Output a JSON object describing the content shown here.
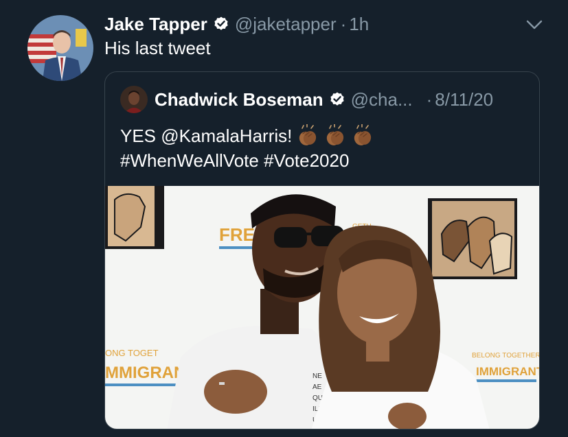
{
  "tweet": {
    "author_name": "Jake Tapper",
    "handle": "@jaketapper",
    "separator": "·",
    "time": "1h",
    "text": "His last tweet"
  },
  "quote": {
    "author_name": "Chadwick Boseman",
    "handle": "@cha...",
    "separator": "·",
    "time": "8/11/20",
    "line1": "YES @KamalaHarris!",
    "line2": "#WhenWeAllVote #Vote2020",
    "emoji": [
      "clapping-hands-medium-dark",
      "clapping-hands-medium-dark",
      "clapping-hands-medium-dark"
    ]
  },
  "photo": {
    "backdrop_text": {
      "freedom": "FREED",
      "belong_left": "ONG TOGET",
      "immigrants_left": "MMIGRAN",
      "belong_right": "BELONG TOGETHER",
      "immigrants_right": "IMMIGRANTS!",
      "shirt": "NE\nAE\nQUL\nILL\nUSR",
      "top_sign": "GETH"
    }
  },
  "colors": {
    "background": "#15202b",
    "muted": "#8899a6",
    "border": "#38444d",
    "verified": "#ffffff"
  },
  "icons": [
    "verified-badge-icon",
    "chevron-down-icon",
    "clap-icon"
  ]
}
